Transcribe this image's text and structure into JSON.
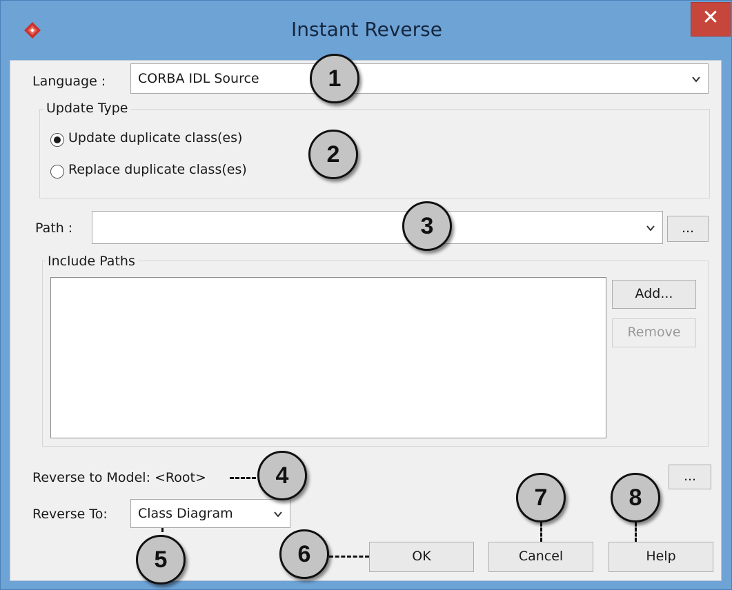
{
  "window": {
    "title": "Instant Reverse",
    "close_glyph": "✕",
    "app_icon": "visual-paradigm-logo-icon"
  },
  "language": {
    "label": "Language :",
    "value": "CORBA IDL Source"
  },
  "update_type": {
    "title": "Update Type",
    "options": [
      {
        "label": "Update duplicate class(es)",
        "selected": true
      },
      {
        "label": "Replace duplicate class(es)",
        "selected": false
      }
    ]
  },
  "path": {
    "label": "Path :",
    "value": "",
    "browse_label": "..."
  },
  "include_paths": {
    "title": "Include Paths",
    "items": [],
    "add_label": "Add...",
    "remove_label": "Remove"
  },
  "reverse_model": {
    "label": "Reverse to Model: <Root>",
    "browse_label": "..."
  },
  "reverse_to": {
    "label": "Reverse To:",
    "value": "Class Diagram"
  },
  "buttons": {
    "ok": "OK",
    "cancel": "Cancel",
    "help": "Help"
  },
  "callouts": [
    "1",
    "2",
    "3",
    "4",
    "5",
    "6",
    "7",
    "8"
  ]
}
